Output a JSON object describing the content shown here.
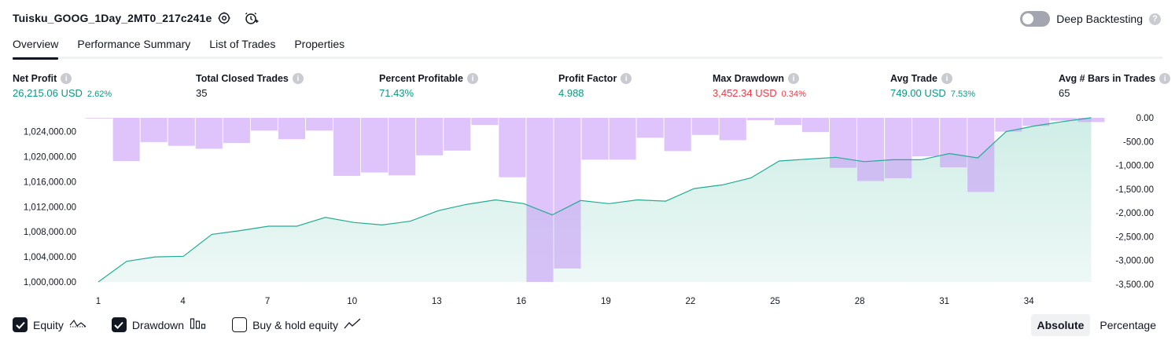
{
  "header": {
    "strategy_name": "Tuisku_GOOG_1Day_2MT0_217c241e",
    "deep_backtesting_label": "Deep Backtesting",
    "deep_backtesting_enabled": false
  },
  "tabs": [
    {
      "label": "Overview",
      "active": true
    },
    {
      "label": "Performance Summary",
      "active": false
    },
    {
      "label": "List of Trades",
      "active": false
    },
    {
      "label": "Properties",
      "active": false
    }
  ],
  "metrics": [
    {
      "label": "Net Profit",
      "value": "26,215.06 USD",
      "pct": "2.62%",
      "tone": "green"
    },
    {
      "label": "Total Closed Trades",
      "value": "35",
      "pct": "",
      "tone": "neutral"
    },
    {
      "label": "Percent Profitable",
      "value": "71.43%",
      "pct": "",
      "tone": "green"
    },
    {
      "label": "Profit Factor",
      "value": "4.988",
      "pct": "",
      "tone": "green"
    },
    {
      "label": "Max Drawdown",
      "value": "3,452.34 USD",
      "pct": "0.34%",
      "tone": "red"
    },
    {
      "label": "Avg Trade",
      "value": "749.00 USD",
      "pct": "7.53%",
      "tone": "green"
    },
    {
      "label": "Avg # Bars in Trades",
      "value": "65",
      "pct": "",
      "tone": "neutral"
    }
  ],
  "legend": {
    "equity_label": "Equity",
    "equity_checked": true,
    "drawdown_label": "Drawdown",
    "drawdown_checked": true,
    "buyhold_label": "Buy & hold equity",
    "buyhold_checked": false
  },
  "view_mode": {
    "absolute_label": "Absolute",
    "percentage_label": "Percentage",
    "selected": "Absolute"
  },
  "colors": {
    "equity_line": "#22ab94",
    "equity_fill": "#cdece5",
    "drawdown_bar": "#e1c3fb",
    "overlap": "#b7b5ec",
    "positive": "#089981",
    "negative": "#f23645"
  },
  "chart_data": {
    "type": "area",
    "x": [
      1,
      2,
      3,
      4,
      5,
      6,
      7,
      8,
      9,
      10,
      11,
      12,
      13,
      14,
      15,
      16,
      17,
      18,
      19,
      20,
      21,
      22,
      23,
      24,
      25,
      26,
      27,
      28,
      29,
      30,
      31,
      32,
      33,
      34,
      35,
      36,
      37
    ],
    "x_ticks": [
      1,
      4,
      7,
      10,
      13,
      16,
      19,
      22,
      25,
      28,
      31,
      34
    ],
    "series": [
      {
        "name": "Equity",
        "axis": "left",
        "values": [
          1000000,
          1003300,
          1004000,
          1004100,
          1007600,
          1008200,
          1008900,
          1008900,
          1010300,
          1009500,
          1009100,
          1009700,
          1011400,
          1012400,
          1013100,
          1012500,
          1010700,
          1013000,
          1012500,
          1013100,
          1012900,
          1014900,
          1015500,
          1016600,
          1019300,
          1019600,
          1019900,
          1019200,
          1019500,
          1019500,
          1020500,
          1019800,
          1024000,
          1024900,
          1025600,
          1026215
        ]
      },
      {
        "name": "Drawdown",
        "axis": "right",
        "values": [
          0,
          -910,
          -510,
          -590,
          -650,
          -530,
          -270,
          -450,
          -270,
          -1220,
          -1150,
          -1210,
          -790,
          -690,
          -150,
          -1250,
          -3452,
          -3170,
          -880,
          -880,
          -420,
          -700,
          -360,
          -470,
          -50,
          -150,
          -300,
          -1050,
          -1330,
          -1270,
          -810,
          -1040,
          -1560,
          -290,
          -170,
          -60,
          -90
        ]
      }
    ],
    "ylim_left": [
      1000000,
      1026200
    ],
    "yticks_left": [
      "1,000,000.00",
      "1,004,000.00",
      "1,008,000.00",
      "1,012,000.00",
      "1,016,000.00",
      "1,020,000.00",
      "1,024,000.00"
    ],
    "yticks_left_values": [
      1000000,
      1004000,
      1008000,
      1012000,
      1016000,
      1020000,
      1024000
    ],
    "ylim_right": [
      -3452,
      0
    ],
    "yticks_right": [
      "0.00",
      "-500.00",
      "-1,000.00",
      "-1,500.00",
      "-2,000.00",
      "-2,500.00",
      "-3,000.00",
      "-3,500.00"
    ],
    "yticks_right_values": [
      0,
      -500,
      -1000,
      -1500,
      -2000,
      -2500,
      -3000,
      -3500
    ],
    "grid": false
  }
}
